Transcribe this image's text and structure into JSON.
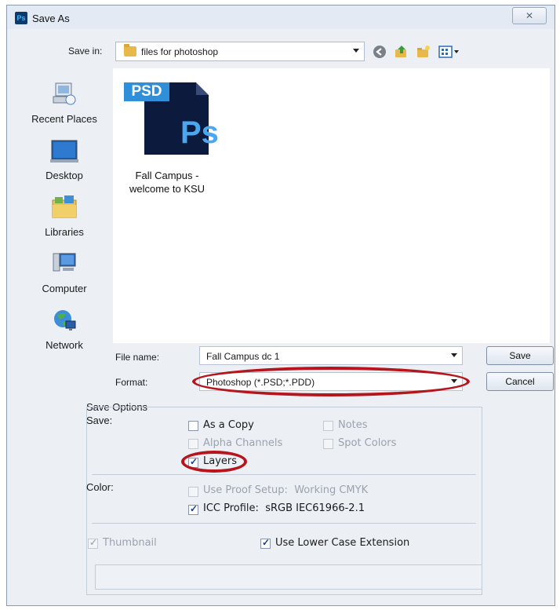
{
  "window": {
    "title": "Save As",
    "app_icon": "Ps",
    "close_glyph": "✕"
  },
  "save_in": {
    "label": "Save in:",
    "value": "files for photoshop"
  },
  "toolbar": {
    "icons": [
      "back-icon",
      "up-folder-icon",
      "new-folder-icon",
      "view-menu-icon"
    ]
  },
  "places": [
    {
      "label": "Recent Places",
      "icon": "recent-places-icon"
    },
    {
      "label": "Desktop",
      "icon": "desktop-icon"
    },
    {
      "label": "Libraries",
      "icon": "libraries-icon"
    },
    {
      "label": "Computer",
      "icon": "computer-icon"
    },
    {
      "label": "Network",
      "icon": "network-icon"
    }
  ],
  "files": [
    {
      "badge": "PSD",
      "logo": "Ps",
      "name_line1": "Fall Campus -",
      "name_line2": "welcome to KSU"
    }
  ],
  "form": {
    "file_name_label": "File name:",
    "file_name_value": "Fall Campus dc 1",
    "format_label": "Format:",
    "format_value": "Photoshop (*.PSD;*.PDD)",
    "save_button": "Save",
    "cancel_button": "Cancel"
  },
  "save_options": {
    "group_title": "Save Options",
    "save_label": "Save:",
    "as_a_copy": {
      "label": "As a Copy",
      "checked": false,
      "enabled": true
    },
    "notes": {
      "label": "Notes",
      "checked": false,
      "enabled": false
    },
    "alpha_channels": {
      "label": "Alpha Channels",
      "checked": false,
      "enabled": false
    },
    "spot_colors": {
      "label": "Spot Colors",
      "checked": false,
      "enabled": false
    },
    "layers": {
      "label": "Layers",
      "checked": true,
      "enabled": true
    },
    "color_label": "Color:",
    "use_proof_setup": {
      "label": "Use Proof Setup:",
      "value": "Working CMYK",
      "checked": false,
      "enabled": false
    },
    "icc_profile": {
      "label": "ICC Profile:",
      "value": "sRGB IEC61966-2.1",
      "checked": true,
      "enabled": true
    },
    "thumbnail": {
      "label": "Thumbnail",
      "checked": true,
      "enabled": false
    },
    "lower_case_ext": {
      "label": "Use Lower Case Extension",
      "checked": true,
      "enabled": true
    }
  },
  "colors": {
    "highlight_oval": "#b6151c",
    "window_bg": "#ecf0f5",
    "psd_blue": "#2f8fd8",
    "psd_dark": "#0c1a3e"
  }
}
